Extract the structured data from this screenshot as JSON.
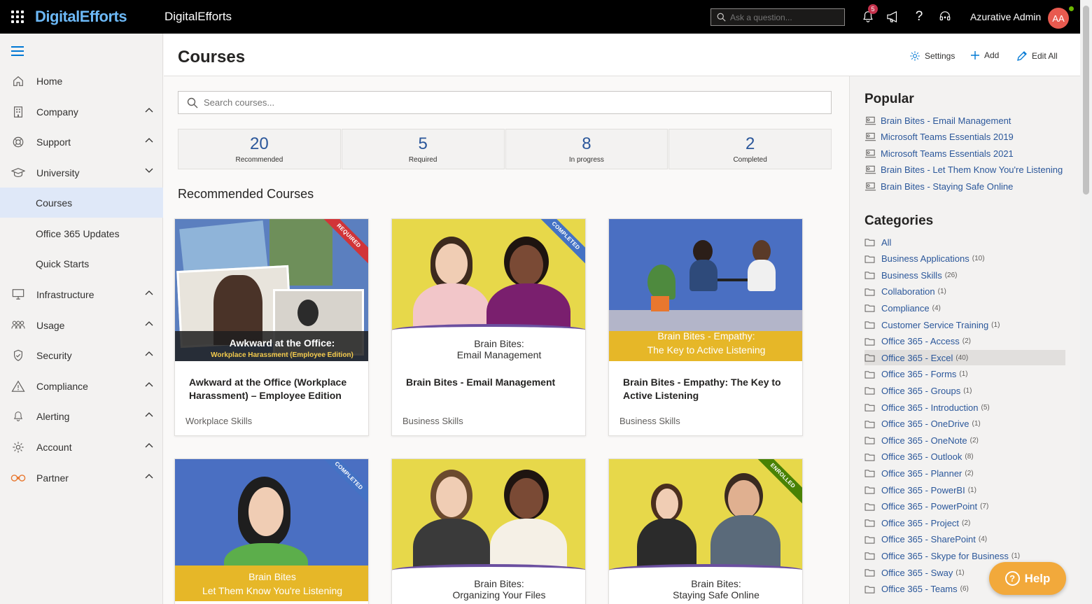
{
  "topbar": {
    "brand": "DigitalEfforts",
    "app_title": "DigitalEfforts",
    "search_placeholder": "Ask a question...",
    "notification_count": "5",
    "user_name": "Azurative Admin",
    "user_initials": "AA"
  },
  "sidebar": {
    "items": [
      {
        "label": "Home",
        "icon": "home-icon"
      },
      {
        "label": "Company",
        "icon": "building-icon"
      },
      {
        "label": "Support",
        "icon": "lifebuoy-icon"
      },
      {
        "label": "University",
        "icon": "graduation-cap-icon"
      },
      {
        "label": "Infrastructure",
        "icon": "monitor-icon"
      },
      {
        "label": "Usage",
        "icon": "people-icon"
      },
      {
        "label": "Security",
        "icon": "shield-icon"
      },
      {
        "label": "Compliance",
        "icon": "warning-icon"
      },
      {
        "label": "Alerting",
        "icon": "bell-icon"
      },
      {
        "label": "Account",
        "icon": "gear-icon"
      },
      {
        "label": "Partner",
        "icon": "handshake-icon"
      }
    ],
    "subitems": [
      {
        "label": "Courses"
      },
      {
        "label": "Office 365 Updates"
      },
      {
        "label": "Quick Starts"
      }
    ]
  },
  "header": {
    "title": "Courses",
    "settings_label": "Settings",
    "add_label": "Add",
    "edit_all_label": "Edit All"
  },
  "content": {
    "search_placeholder": "Search courses...",
    "stats": [
      {
        "value": "20",
        "label": "Recommended"
      },
      {
        "value": "5",
        "label": "Required"
      },
      {
        "value": "8",
        "label": "In progress"
      },
      {
        "value": "2",
        "label": "Completed"
      }
    ],
    "section_title": "Recommended Courses",
    "courses": [
      {
        "title": "Awkward at the Office (Workplace Harassment) – Employee Edition",
        "category": "Workplace Skills",
        "ribbon": "REQUIRED",
        "ribbon_color": "#d13438",
        "thumb_line1": "Awkward at the Office:",
        "thumb_line2": "Workplace Harassment (Employee Edition)"
      },
      {
        "title": "Brain Bites - Email Management",
        "category": "Business Skills",
        "ribbon": "COMPLETED",
        "ribbon_color": "#4472c4",
        "thumb_line1": "Brain Bites:",
        "thumb_line2": "Email Management"
      },
      {
        "title": "Brain Bites - Empathy: The Key to Active Listening",
        "category": "Business Skills",
        "ribbon": "",
        "thumb_line1": "Brain Bites - Empathy:",
        "thumb_line2": "The Key to Active Listening"
      },
      {
        "title": "",
        "category": "",
        "ribbon": "COMPLETED",
        "ribbon_color": "#4472c4",
        "thumb_line1": "Brain Bites",
        "thumb_line2": "Let Them Know You're Listening"
      },
      {
        "title": "",
        "category": "",
        "ribbon": "",
        "thumb_line1": "Brain Bites:",
        "thumb_line2": "Organizing Your Files"
      },
      {
        "title": "",
        "category": "",
        "ribbon": "ENROLLED",
        "ribbon_color": "#498205",
        "thumb_line1": "Brain Bites:",
        "thumb_line2": "Staying Safe Online"
      }
    ]
  },
  "popular": {
    "title": "Popular",
    "items": [
      "Brain Bites - Email Management",
      "Microsoft Teams Essentials 2019",
      "Microsoft Teams Essentials 2021",
      "Brain Bites - Let Them Know You're Listening",
      "Brain Bites - Staying Safe Online"
    ]
  },
  "categories": {
    "title": "Categories",
    "items": [
      {
        "label": "All",
        "count": ""
      },
      {
        "label": "Business Applications",
        "count": "(10)"
      },
      {
        "label": "Business Skills",
        "count": "(26)"
      },
      {
        "label": "Collaboration",
        "count": "(1)"
      },
      {
        "label": "Compliance",
        "count": "(4)"
      },
      {
        "label": "Customer Service Training",
        "count": "(1)"
      },
      {
        "label": "Office 365 - Access",
        "count": "(2)"
      },
      {
        "label": "Office 365 - Excel",
        "count": "(40)"
      },
      {
        "label": "Office 365 - Forms",
        "count": "(1)"
      },
      {
        "label": "Office 365 - Groups",
        "count": "(1)"
      },
      {
        "label": "Office 365 - Introduction",
        "count": "(5)"
      },
      {
        "label": "Office 365 - OneDrive",
        "count": "(1)"
      },
      {
        "label": "Office 365 - OneNote",
        "count": "(2)"
      },
      {
        "label": "Office 365 - Outlook",
        "count": "(8)"
      },
      {
        "label": "Office 365 - Planner",
        "count": "(2)"
      },
      {
        "label": "Office 365 - PowerBI",
        "count": "(1)"
      },
      {
        "label": "Office 365 - PowerPoint",
        "count": "(7)"
      },
      {
        "label": "Office 365 - Project",
        "count": "(2)"
      },
      {
        "label": "Office 365 - SharePoint",
        "count": "(4)"
      },
      {
        "label": "Office 365 - Skype for Business",
        "count": "(1)"
      },
      {
        "label": "Office 365 - Sway",
        "count": "(1)"
      },
      {
        "label": "Office 365 - Teams",
        "count": "(6)"
      }
    ]
  },
  "help": {
    "label": "Help"
  }
}
